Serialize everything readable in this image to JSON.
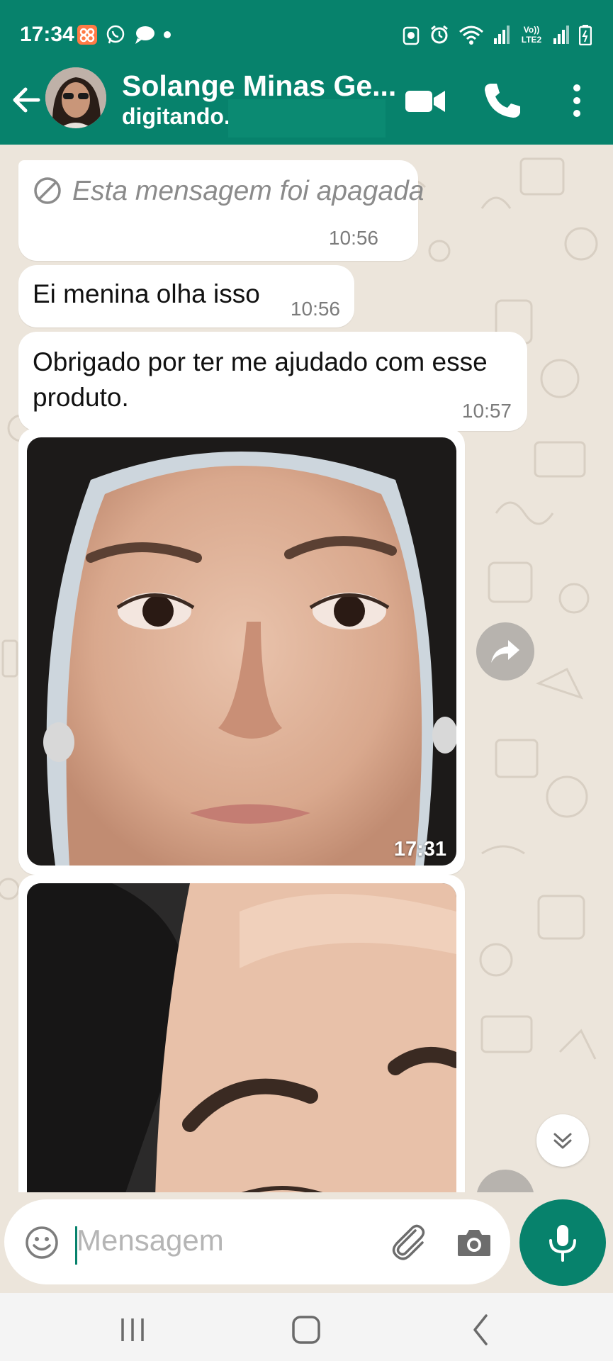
{
  "status_bar": {
    "time": "17:34",
    "network_label": "Vo)) LTE2"
  },
  "header": {
    "contact_name": "Solange Minas Ge...",
    "contact_status": "digitando..."
  },
  "messages": [
    {
      "type": "deleted",
      "text": "Esta mensagem foi apagada",
      "time": "10:56",
      "icon": "blocked-icon"
    },
    {
      "type": "text",
      "text": "Ei menina olha isso",
      "time": "10:56"
    },
    {
      "type": "text",
      "text": "Obrigado por ter me ajudado com esse produto.",
      "time": "10:57"
    },
    {
      "type": "image",
      "time": "17:31"
    },
    {
      "type": "image",
      "time": ""
    }
  ],
  "composer": {
    "placeholder": "Mensagem"
  },
  "colors": {
    "header_green": "#07826c",
    "chat_background": "#ece5db",
    "bubble": "#ffffff",
    "time_text": "#7b7b7b"
  }
}
